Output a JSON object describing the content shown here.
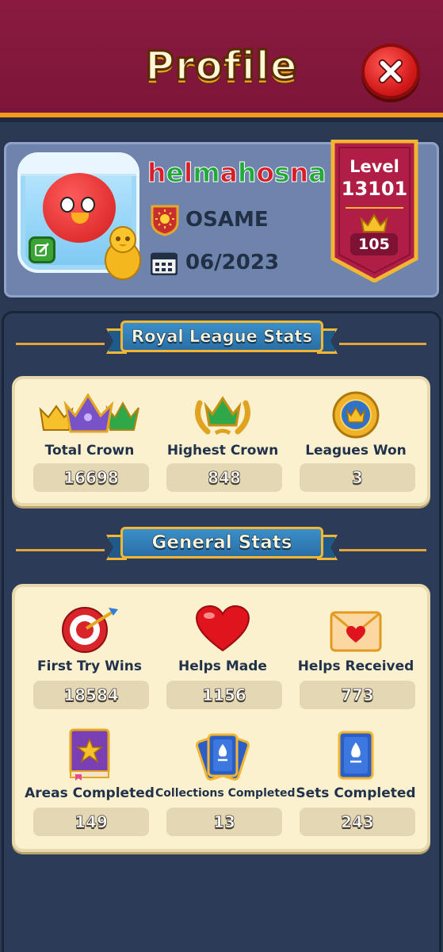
{
  "header": {
    "title": "Profile",
    "close_icon": "close-icon"
  },
  "profile": {
    "username_chars": [
      "h",
      "e",
      "l",
      "m",
      "a",
      "h",
      "o",
      "s",
      "n",
      "a"
    ],
    "username": "helmahosna",
    "team": {
      "name": "OSAME",
      "icon": "team-sun-badge-icon"
    },
    "join_date": "06/2023",
    "level_label": "Level",
    "level": "13101",
    "crowns": "105",
    "colors": {
      "username_a": "#d61f2a",
      "username_b": "#23a83a",
      "banner": "#b01e45"
    }
  },
  "royal_league": {
    "title": "Royal League Stats",
    "stats": [
      {
        "label": "Total Crown",
        "value": "16698",
        "icon": "crowns-icon"
      },
      {
        "label": "Highest Crown",
        "value": "848",
        "icon": "laurel-crown-icon"
      },
      {
        "label": "Leagues Won",
        "value": "3",
        "icon": "league-medal-icon"
      }
    ]
  },
  "general": {
    "title": "General Stats",
    "stats": [
      {
        "label": "First Try Wins",
        "value": "18584",
        "icon": "target-icon"
      },
      {
        "label": "Helps Made",
        "value": "1156",
        "icon": "heart-icon"
      },
      {
        "label": "Helps Received",
        "value": "773",
        "icon": "heart-envelope-icon"
      },
      {
        "label": "Areas Completed",
        "value": "149",
        "icon": "book-icon"
      },
      {
        "label": "Collections Completed",
        "value": "13",
        "icon": "card-fan-icon"
      },
      {
        "label": "Sets Completed",
        "value": "243",
        "icon": "card-icon"
      }
    ]
  }
}
